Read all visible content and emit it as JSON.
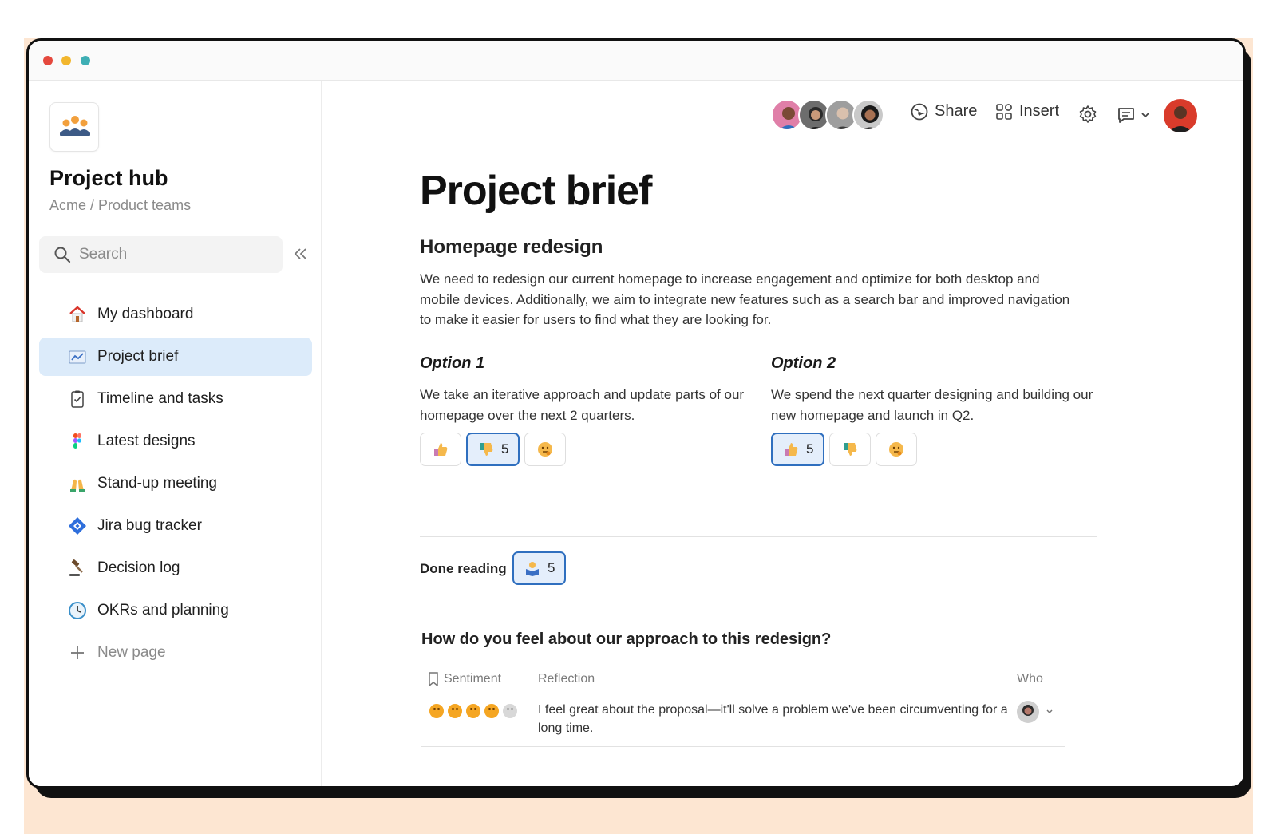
{
  "sidebar": {
    "hub_title": "Project hub",
    "breadcrumb": "Acme / Product teams",
    "search_placeholder": "Search",
    "items": [
      {
        "label": "My dashboard",
        "icon": "house-icon"
      },
      {
        "label": "Project brief",
        "icon": "chart-icon",
        "active": true
      },
      {
        "label": "Timeline and tasks",
        "icon": "clipboard-check-icon"
      },
      {
        "label": "Latest designs",
        "icon": "figma-icon"
      },
      {
        "label": "Stand-up meeting",
        "icon": "raised-hands-icon"
      },
      {
        "label": "Jira bug tracker",
        "icon": "jira-icon"
      },
      {
        "label": "Decision log",
        "icon": "gavel-icon"
      },
      {
        "label": "OKRs and planning",
        "icon": "clock-icon"
      },
      {
        "label": "New page",
        "icon": "plus-icon"
      }
    ]
  },
  "toolbar": {
    "share_label": "Share",
    "insert_label": "Insert"
  },
  "doc": {
    "title": "Project brief",
    "subtitle": "Homepage redesign",
    "body": "We need to redesign our current homepage to increase engagement and optimize for both desktop and mobile devices. Additionally, we aim to integrate new features such as a search bar and improved navigation to make it easier for users to find what they are looking for.",
    "option1": {
      "title": "Option 1",
      "desc": "We take an iterative approach and update parts of our homepage over the next 2 quarters.",
      "reactions": [
        {
          "icon": "thumbs-up-icon",
          "count": ""
        },
        {
          "icon": "thumbs-down-icon",
          "count": "5",
          "selected": true
        },
        {
          "icon": "thinking-face-icon",
          "count": ""
        }
      ]
    },
    "option2": {
      "title": "Option 2",
      "desc": "We spend the next quarter designing and building our new homepage and launch in Q2.",
      "reactions": [
        {
          "icon": "thumbs-up-icon",
          "count": "5",
          "selected": true
        },
        {
          "icon": "thumbs-down-icon",
          "count": ""
        },
        {
          "icon": "thinking-face-icon",
          "count": ""
        }
      ]
    },
    "done_reading_label": "Done reading",
    "done_reading_count": "5",
    "question": "How do you feel about our approach to this redesign?",
    "table": {
      "headers": [
        "Sentiment",
        "Reflection",
        "Who"
      ],
      "rows": [
        {
          "sentiment_filled": 4,
          "sentiment_total": 5,
          "reflection": "I feel great about the proposal—it'll solve a problem we've been circumventing for a long time."
        }
      ]
    }
  },
  "colors": {
    "accent": "#2f6fbf",
    "active_nav_bg": "#dcebfa",
    "backdrop": "#fde6d2"
  }
}
